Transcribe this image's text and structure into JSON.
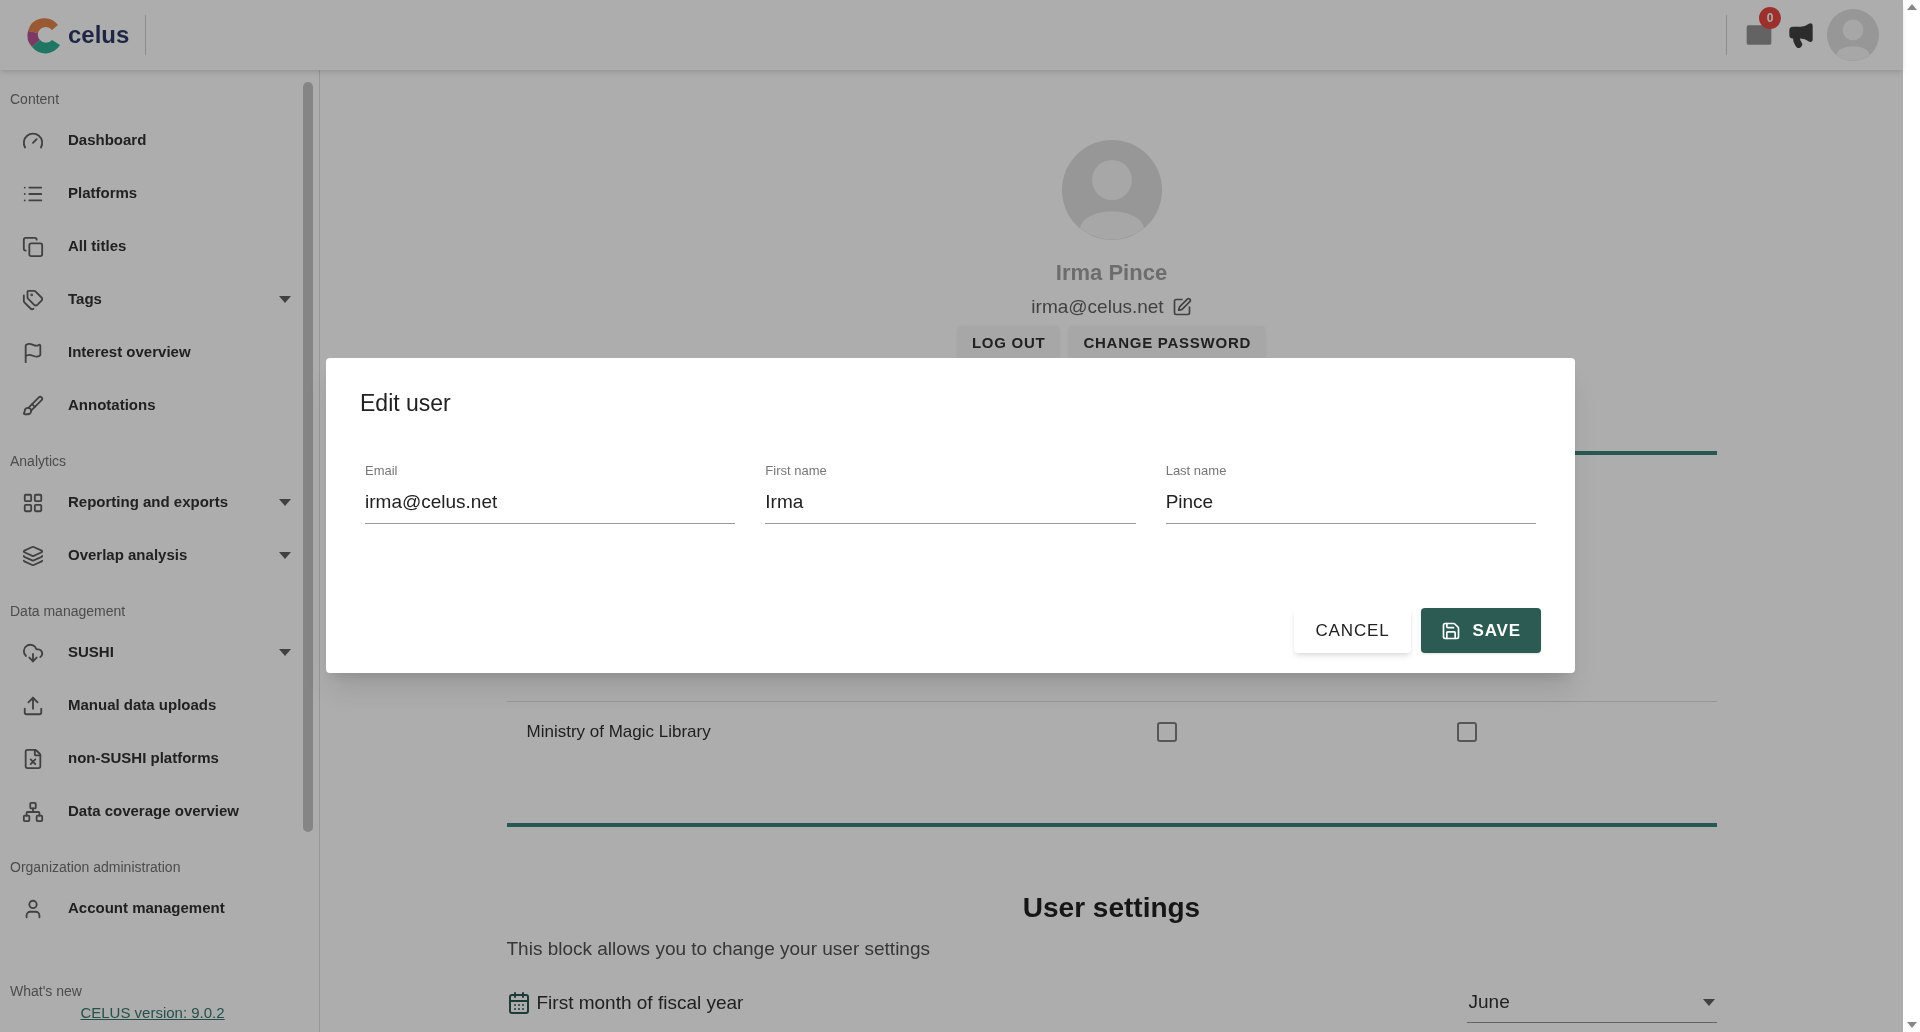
{
  "header": {
    "logo_text": "celus",
    "notifications": {
      "count": "0"
    }
  },
  "sidebar": {
    "sections": [
      {
        "title": "Content",
        "items": [
          {
            "label": "Dashboard",
            "expandable": false
          },
          {
            "label": "Platforms",
            "expandable": false
          },
          {
            "label": "All titles",
            "expandable": false
          },
          {
            "label": "Tags",
            "expandable": true
          },
          {
            "label": "Interest overview",
            "expandable": false
          },
          {
            "label": "Annotations",
            "expandable": false
          }
        ]
      },
      {
        "title": "Analytics",
        "items": [
          {
            "label": "Reporting and exports",
            "expandable": true
          },
          {
            "label": "Overlap analysis",
            "expandable": true
          }
        ]
      },
      {
        "title": "Data management",
        "items": [
          {
            "label": "SUSHI",
            "expandable": true
          },
          {
            "label": "Manual data uploads",
            "expandable": false
          },
          {
            "label": "non-SUSHI platforms",
            "expandable": false
          },
          {
            "label": "Data coverage overview",
            "expandable": false
          }
        ]
      },
      {
        "title": "Organization administration",
        "items": [
          {
            "label": "Account management",
            "expandable": false
          }
        ]
      }
    ],
    "footer": {
      "title": "What's new",
      "version_link": "CELUS version: 9.0.2"
    }
  },
  "profile": {
    "name": "Irma Pince",
    "email": "irma@celus.net",
    "buttons": [
      "LOG OUT",
      "CHANGE PASSWORD"
    ]
  },
  "organizations": {
    "rows": [
      {
        "name": "Ministry of Magic Library",
        "checkboxes": [
          {
            "checked": false
          },
          {
            "checked": false
          }
        ]
      }
    ]
  },
  "user_settings": {
    "title": "User settings",
    "description": "This block allows you to change your user settings",
    "fields": [
      {
        "label": "First month of fiscal year",
        "value": "June"
      }
    ]
  },
  "dialog": {
    "title": "Edit user",
    "fields": [
      {
        "label": "Email",
        "value": "irma@celus.net"
      },
      {
        "label": "First name",
        "value": "Irma"
      },
      {
        "label": "Last name",
        "value": "Pince"
      }
    ],
    "buttons": [
      {
        "label": "CANCEL",
        "kind": "text"
      },
      {
        "label": "SAVE",
        "kind": "primary"
      }
    ]
  }
}
